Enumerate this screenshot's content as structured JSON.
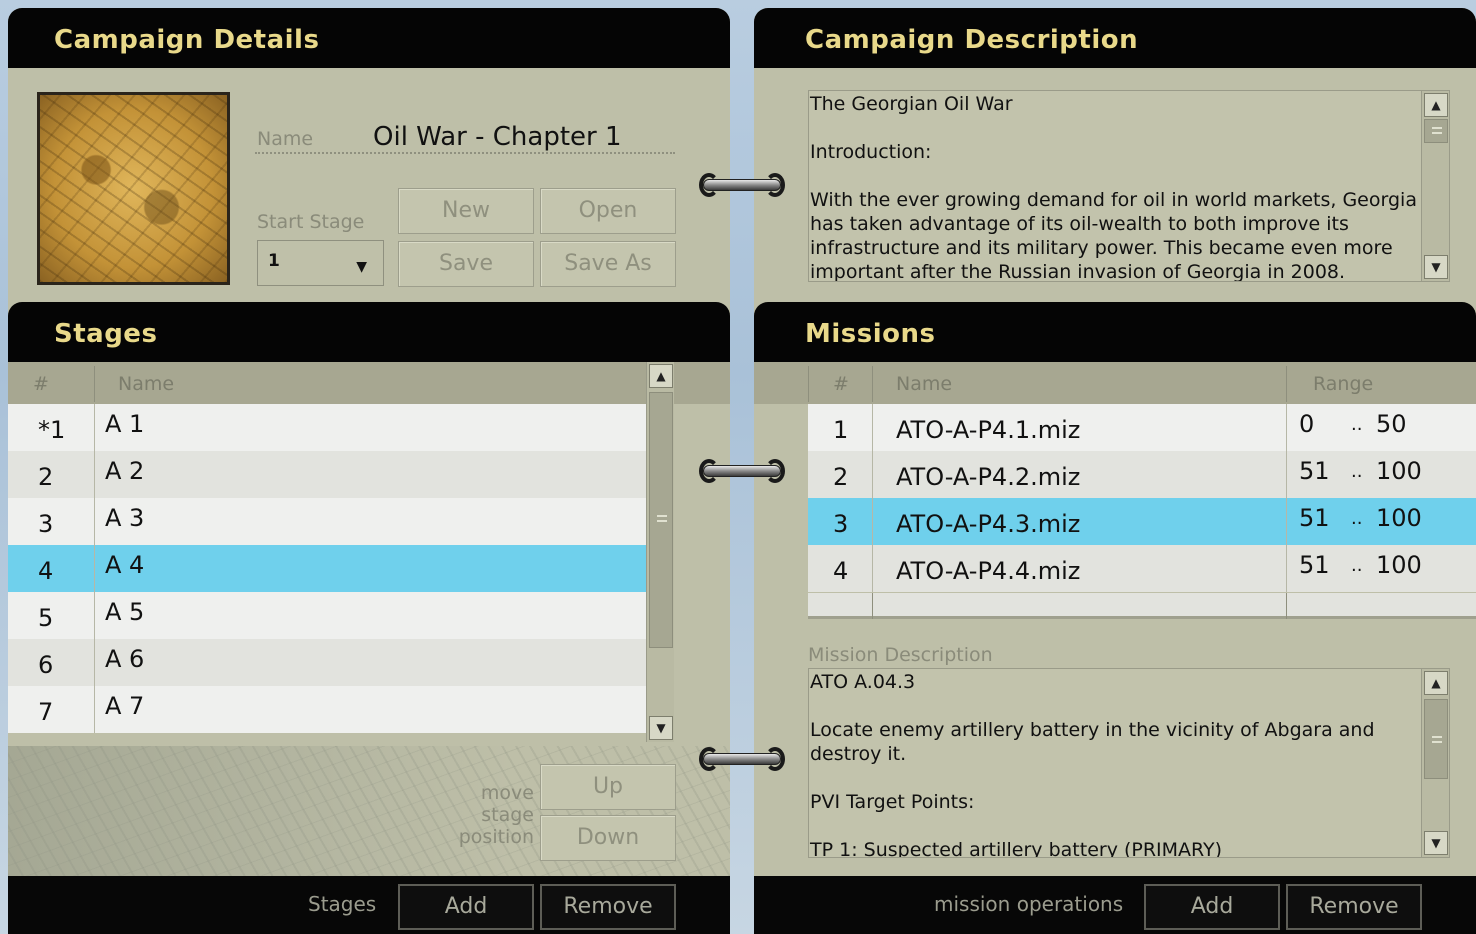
{
  "campaign_details": {
    "title": "Campaign Details",
    "name_label": "Name",
    "name_value": "Oil War - Chapter 1",
    "start_stage_label": "Start Stage",
    "start_stage_value": "1",
    "buttons": {
      "new": "New",
      "open": "Open",
      "save": "Save",
      "save_as": "Save As"
    }
  },
  "campaign_description": {
    "title": "Campaign Description",
    "paragraphs": [
      "The Georgian Oil War",
      "Introduction:",
      "With the ever growing demand for oil in world markets, Georgia has taken advantage of its oil-wealth to both improve its infrastructure and its military power.  This became even more important after the Russian invasion of Georgia in 2008."
    ]
  },
  "stages": {
    "title": "Stages",
    "columns": [
      "#",
      "Name"
    ],
    "rows": [
      {
        "num": "*1",
        "name": "A 1"
      },
      {
        "num": "2",
        "name": "A 2"
      },
      {
        "num": "3",
        "name": "A 3"
      },
      {
        "num": "4",
        "name": "A 4"
      },
      {
        "num": "5",
        "name": "A 5"
      },
      {
        "num": "6",
        "name": "A 6"
      },
      {
        "num": "7",
        "name": "A 7"
      }
    ],
    "selected_row": 3,
    "move_label_lines": [
      "move",
      "stage",
      "position"
    ],
    "up_label": "Up",
    "down_label": "Down",
    "footer_label": "Stages",
    "add_label": "Add",
    "remove_label": "Remove"
  },
  "missions": {
    "title": "Missions",
    "columns": [
      "#",
      "Name",
      "Range"
    ],
    "rows": [
      {
        "num": "1",
        "name": "ATO-A-P4.1.miz",
        "from": "0",
        "sep": "..",
        "to": "50"
      },
      {
        "num": "2",
        "name": "ATO-A-P4.2.miz",
        "from": "51",
        "sep": "..",
        "to": "100"
      },
      {
        "num": "3",
        "name": "ATO-A-P4.3.miz",
        "from": "51",
        "sep": "..",
        "to": "100"
      },
      {
        "num": "4",
        "name": "ATO-A-P4.4.miz",
        "from": "51",
        "sep": "..",
        "to": "100"
      }
    ],
    "selected_row": 2,
    "mission_description_label": "Mission Description",
    "mission_description": [
      "ATO A.04.3",
      "Locate enemy artillery battery in the vicinity of Abgara and destroy it.",
      "PVI Target Points:",
      "TP 1: Suspected artillery battery (PRIMARY)"
    ],
    "footer_label": "mission operations",
    "add_label": "Add",
    "remove_label": "Remove"
  },
  "colors": {
    "header_bg": "#050505",
    "header_text": "#e9d98a",
    "panel_bg": "#bebfa8",
    "selection": "#6fd0ec"
  },
  "icons": {
    "scroll_up": "chevron-up-icon",
    "scroll_down": "chevron-down-icon",
    "dropdown": "dropdown-arrow-icon",
    "binder_ring": "binder-ring-icon"
  }
}
